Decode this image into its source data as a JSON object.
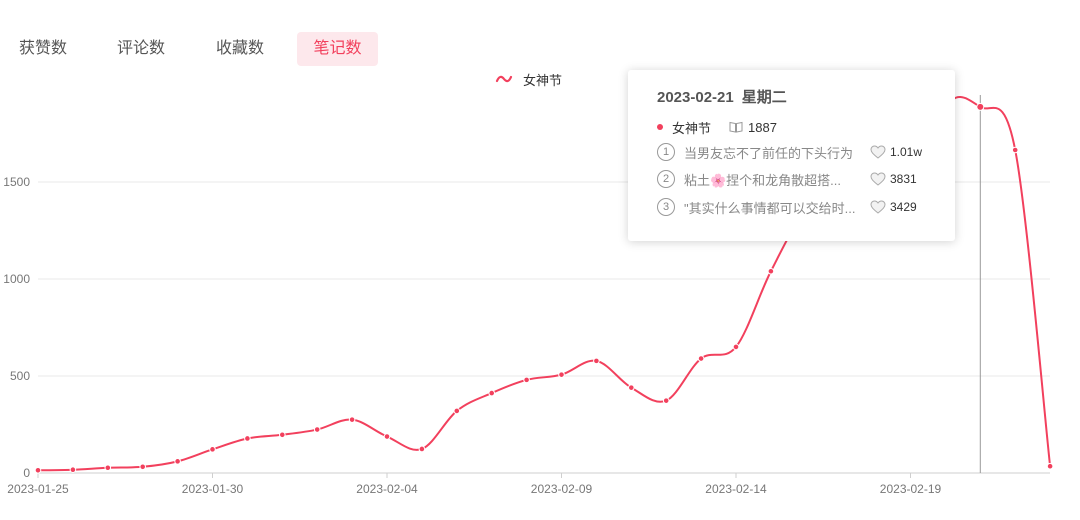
{
  "tabs": [
    {
      "label": "获赞数",
      "active": false
    },
    {
      "label": "评论数",
      "active": false
    },
    {
      "label": "收藏数",
      "active": false
    },
    {
      "label": "笔记数",
      "active": true
    }
  ],
  "legend": {
    "label": "女神节",
    "icon": "wave-line-icon",
    "color": "#f2405d"
  },
  "tooltip": {
    "date": "2023-02-21",
    "weekday": "星期二",
    "series_name": "女神节",
    "series_value": "1887",
    "top_notes": [
      {
        "rank": "1",
        "title": "当男友忘不了前任的下头行为",
        "likes": "1.01w"
      },
      {
        "rank": "2",
        "title": "粘土🌸捏个和龙角散超搭...",
        "likes": "3831"
      },
      {
        "rank": "3",
        "title": "\"其实什么事情都可以交给时...",
        "likes": "3429"
      }
    ]
  },
  "chart_data": {
    "type": "line",
    "x": [
      "2023-01-25",
      "2023-01-26",
      "2023-01-27",
      "2023-01-28",
      "2023-01-29",
      "2023-01-30",
      "2023-01-31",
      "2023-02-01",
      "2023-02-02",
      "2023-02-03",
      "2023-02-04",
      "2023-02-05",
      "2023-02-06",
      "2023-02-07",
      "2023-02-08",
      "2023-02-09",
      "2023-02-10",
      "2023-02-11",
      "2023-02-12",
      "2023-02-13",
      "2023-02-14",
      "2023-02-15",
      "2023-02-16",
      "2023-02-17",
      "2023-02-18",
      "2023-02-19",
      "2023-02-20",
      "2023-02-21",
      "2023-02-22",
      "2023-02-23"
    ],
    "series": [
      {
        "name": "女神节",
        "color": "#f2405d",
        "values": [
          14,
          17,
          27,
          32,
          60,
          122,
          178,
          197,
          224,
          275,
          188,
          124,
          320,
          412,
          480,
          507,
          578,
          440,
          373,
          590,
          650,
          1040,
          1350,
          1420,
          1280,
          1260,
          1880,
          1887,
          1665,
          35
        ]
      }
    ],
    "xticks": [
      "2023-01-25",
      "2023-01-30",
      "2023-02-04",
      "2023-02-09",
      "2023-02-14",
      "2023-02-19"
    ],
    "yticks": [
      "0",
      "500",
      "1000",
      "1500"
    ],
    "ylim": [
      0,
      2000
    ],
    "grid": true,
    "legend_position": "top-center",
    "highlight_x": "2023-02-21",
    "title": "",
    "xlabel": "",
    "ylabel": ""
  }
}
